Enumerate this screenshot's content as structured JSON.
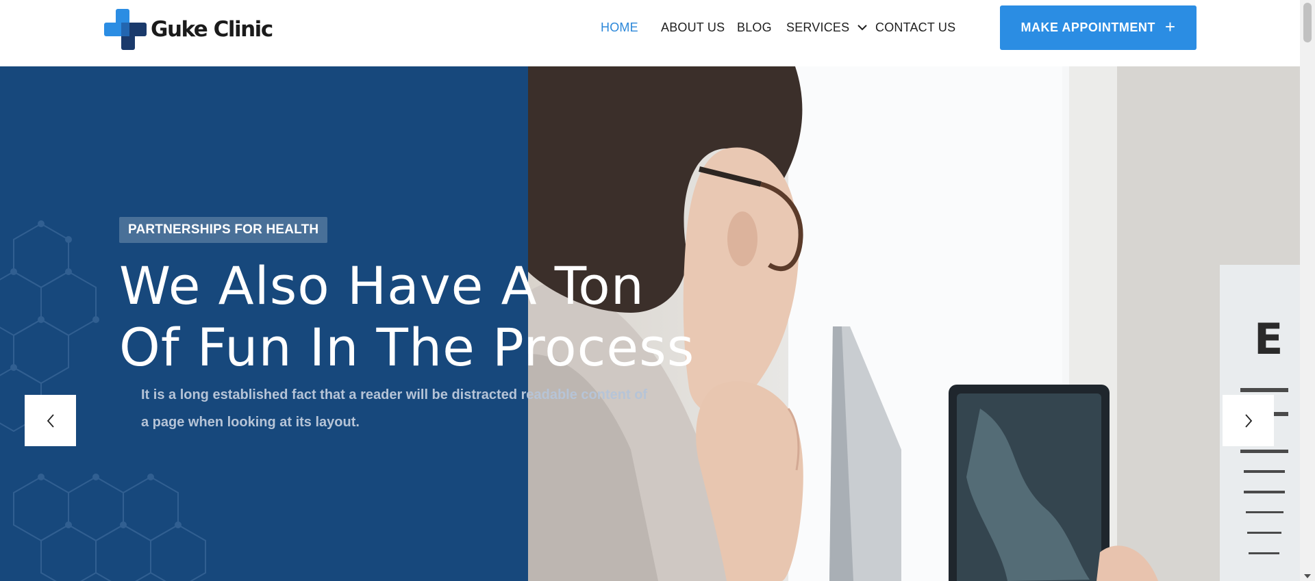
{
  "brand": {
    "name": "Guke Clinic",
    "logo_icon": "medical-cross-icon",
    "colors": {
      "primary": "#2b8de3",
      "dark_blue": "#17487c",
      "logo_dark": "#1a3a6b"
    }
  },
  "nav": {
    "items": [
      {
        "label": "HOME",
        "active": true
      },
      {
        "label": "ABOUT US",
        "active": false
      },
      {
        "label": "BLOG",
        "active": false
      },
      {
        "label": "SERVICES",
        "active": false,
        "icon": "chevron-down-icon"
      },
      {
        "label": "CONTACT US",
        "active": false
      }
    ],
    "cta_label": "MAKE APPOINTMENT",
    "cta_icon": "plus-icon"
  },
  "hero": {
    "badge": "PARTNERSHIPS FOR HEALTH",
    "headline_line1": "We Also Have A Ton",
    "headline_line2": "Of Fun In The Process",
    "description_line1": "It is a long established fact that a reader will be distracted readable content of",
    "description_line2": "a page when looking at its layout.",
    "prev_icon": "chevron-left-icon",
    "next_icon": "chevron-right-icon"
  }
}
